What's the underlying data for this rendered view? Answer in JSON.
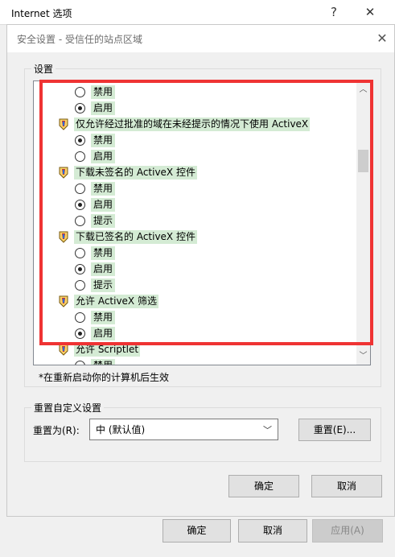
{
  "outer": {
    "title": "Internet 选项",
    "help_glyph": "?",
    "close_glyph": "✕",
    "ok_label": "确定",
    "cancel_label": "取消",
    "apply_label": "应用(A)"
  },
  "dialog": {
    "title": "安全设置 - 受信任的站点区域",
    "close_glyph": "✕",
    "settings_group_label": "设置",
    "items": [
      {
        "kind": "option",
        "label": "禁用",
        "checked": false
      },
      {
        "kind": "option",
        "label": "启用",
        "checked": true
      },
      {
        "kind": "category",
        "label": "仅允许经过批准的域在未经提示的情况下使用 ActiveX"
      },
      {
        "kind": "option",
        "label": "禁用",
        "checked": true
      },
      {
        "kind": "option",
        "label": "启用",
        "checked": false
      },
      {
        "kind": "category",
        "label": "下载未签名的 ActiveX 控件"
      },
      {
        "kind": "option",
        "label": "禁用",
        "checked": false
      },
      {
        "kind": "option",
        "label": "启用",
        "checked": true
      },
      {
        "kind": "option",
        "label": "提示",
        "checked": false
      },
      {
        "kind": "category",
        "label": "下载已签名的 ActiveX 控件"
      },
      {
        "kind": "option",
        "label": "禁用",
        "checked": false
      },
      {
        "kind": "option",
        "label": "启用",
        "checked": true
      },
      {
        "kind": "option",
        "label": "提示",
        "checked": false
      },
      {
        "kind": "category",
        "label": "允许 ActiveX 筛选"
      },
      {
        "kind": "option",
        "label": "禁用",
        "checked": false
      },
      {
        "kind": "option",
        "label": "启用",
        "checked": true
      },
      {
        "kind": "category",
        "label": "允许 Scriptlet"
      },
      {
        "kind": "option",
        "label": "禁用",
        "checked": false
      }
    ],
    "restart_note": "*在重新启动你的计算机后生效",
    "reset_group_label": "重置自定义设置",
    "reset_to_label": "重置为(R):",
    "reset_select_value": "中 (默认值)",
    "reset_button_label": "重置(E)...",
    "ok_label": "确定",
    "cancel_label": "取消"
  },
  "colors": {
    "highlight_border": "#ef3333",
    "label_background": "#d4ebd4"
  }
}
